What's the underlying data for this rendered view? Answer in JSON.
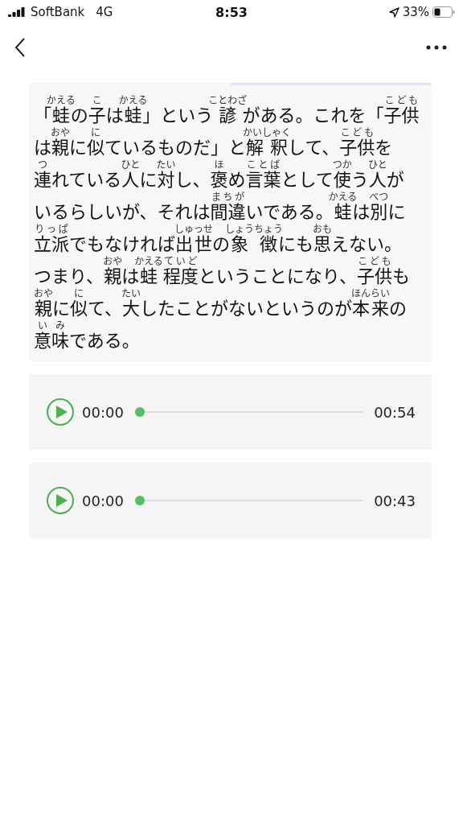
{
  "status_bar": {
    "carrier": "SoftBank",
    "network": "4G",
    "time": "8:53",
    "battery": "33%"
  },
  "passage": {
    "lines": [
      [
        {
          "base": "「"
        },
        {
          "base": "蛙",
          "ruby": "かえる"
        },
        {
          "base": "の"
        },
        {
          "base": "子",
          "ruby": "こ"
        },
        {
          "base": "は"
        },
        {
          "base": "蛙",
          "ruby": "かえる"
        },
        {
          "base": "」という"
        },
        {
          "base": "諺",
          "ruby": "ことわざ"
        },
        {
          "base": "がある。これを「"
        },
        {
          "base": "子供",
          "ruby": "こども"
        }
      ],
      [
        {
          "base": "は"
        },
        {
          "base": "親",
          "ruby": "おや"
        },
        {
          "base": "に"
        },
        {
          "base": "似",
          "ruby": "に"
        },
        {
          "base": "ているものだ」と"
        },
        {
          "base": "解釈",
          "ruby": "かいしゃく"
        },
        {
          "base": "して、"
        },
        {
          "base": "子供",
          "ruby": "こども"
        },
        {
          "base": "を"
        }
      ],
      [
        {
          "base": "連",
          "ruby": "つ"
        },
        {
          "base": "れている"
        },
        {
          "base": "人",
          "ruby": "ひと"
        },
        {
          "base": "に"
        },
        {
          "base": "対",
          "ruby": "たい"
        },
        {
          "base": "し、"
        },
        {
          "base": "褒",
          "ruby": "ほ"
        },
        {
          "base": "め"
        },
        {
          "base": "言葉",
          "ruby": "ことば"
        },
        {
          "base": "として"
        },
        {
          "base": "使",
          "ruby": "つか"
        },
        {
          "base": "う"
        },
        {
          "base": "人",
          "ruby": "ひと"
        },
        {
          "base": "が"
        }
      ],
      [
        {
          "base": "いるらしいが、それは"
        },
        {
          "base": "間違",
          "ruby": "まちが"
        },
        {
          "base": "いである。"
        },
        {
          "base": "蛙",
          "ruby": "かえる"
        },
        {
          "base": "は"
        },
        {
          "base": "別",
          "ruby": "べつ"
        },
        {
          "base": "に"
        }
      ],
      [
        {
          "base": "立派",
          "ruby": "りっぱ"
        },
        {
          "base": "でもなければ"
        },
        {
          "base": "出世",
          "ruby": "しゅっせ"
        },
        {
          "base": "の"
        },
        {
          "base": "象徴",
          "ruby": "しょうちょう"
        },
        {
          "base": "にも"
        },
        {
          "base": "思",
          "ruby": "おも"
        },
        {
          "base": "えない。"
        }
      ],
      [
        {
          "base": "つまり、"
        },
        {
          "base": "親",
          "ruby": "おや"
        },
        {
          "base": "は"
        },
        {
          "base": "蛙",
          "ruby": "かえる"
        },
        {
          "base": "程度",
          "ruby": "ていど"
        },
        {
          "base": "ということになり、"
        },
        {
          "base": "子供",
          "ruby": "こども"
        },
        {
          "base": "も"
        }
      ],
      [
        {
          "base": "親",
          "ruby": "おや"
        },
        {
          "base": "に"
        },
        {
          "base": "似",
          "ruby": "に"
        },
        {
          "base": "て、"
        },
        {
          "base": "大",
          "ruby": "たい"
        },
        {
          "base": "したことがないというのが"
        },
        {
          "base": "本来",
          "ruby": "ほんらい"
        },
        {
          "base": "の"
        }
      ],
      [
        {
          "base": "意味",
          "ruby": "いみ"
        },
        {
          "base": "である。"
        }
      ]
    ]
  },
  "players": [
    {
      "elapsed": "00:00",
      "duration": "00:54",
      "level": 0
    },
    {
      "elapsed": "00:00",
      "duration": "00:43",
      "level": 0
    }
  ]
}
